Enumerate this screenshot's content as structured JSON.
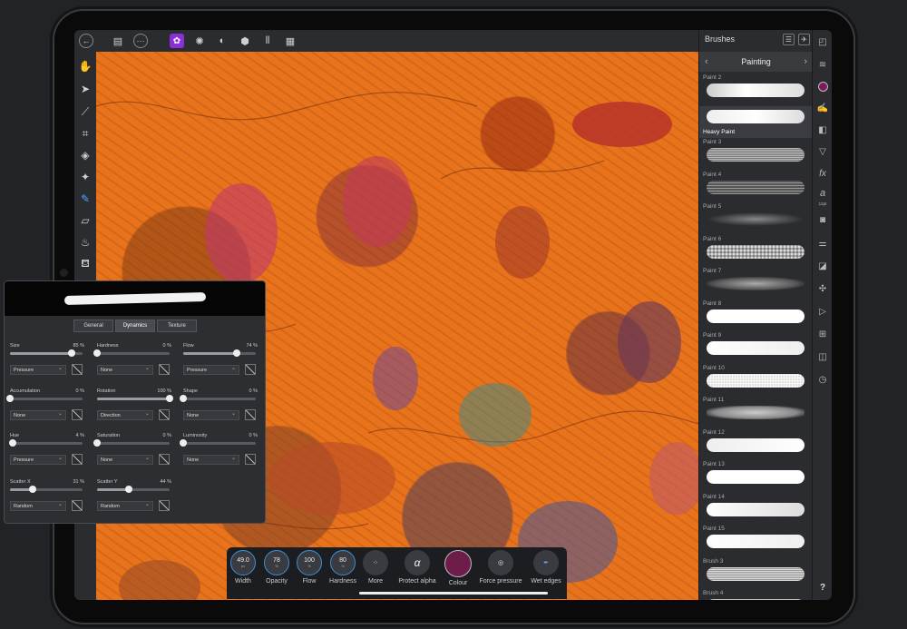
{
  "toolbar": {
    "back_icon": "←",
    "save_icon": "▤",
    "more_icon": "···",
    "persona_label": "✿"
  },
  "studio": {
    "title": "Brushes",
    "category": "Painting",
    "brushes": [
      {
        "label": "Paint 2",
        "selected": false
      },
      {
        "label": "Heavy Paint",
        "selected": true
      },
      {
        "label": "Paint 3",
        "selected": false
      },
      {
        "label": "Paint 4",
        "selected": false
      },
      {
        "label": "Paint 5",
        "selected": false
      },
      {
        "label": "Paint 6",
        "selected": false
      },
      {
        "label": "Paint 7",
        "selected": false
      },
      {
        "label": "Paint 8",
        "selected": false
      },
      {
        "label": "Paint 9",
        "selected": false
      },
      {
        "label": "Paint 10",
        "selected": false
      },
      {
        "label": "Paint 11",
        "selected": false
      },
      {
        "label": "Paint 12",
        "selected": false
      },
      {
        "label": "Paint 13",
        "selected": false
      },
      {
        "label": "Paint 14",
        "selected": false
      },
      {
        "label": "Paint 15",
        "selected": false
      },
      {
        "label": "Brush 3",
        "selected": false
      },
      {
        "label": "Brush 4",
        "selected": false
      }
    ]
  },
  "farright": {
    "font_size_label": "12pt",
    "help": "?"
  },
  "context": {
    "width_value": "49.0",
    "width_unit": "px",
    "width_label": "Width",
    "opacity_value": "78",
    "opacity_unit": "%",
    "opacity_label": "Opacity",
    "flow_value": "100",
    "flow_unit": "%",
    "flow_label": "Flow",
    "hardness_value": "80",
    "hardness_unit": "%",
    "hardness_label": "Hardness",
    "more_label": "More",
    "protect_alpha_label": "Protect alpha",
    "protect_alpha_glyph": "α",
    "colour_label": "Colour",
    "colour_value": "#6e1d4a",
    "force_pressure_label": "Force pressure",
    "wet_edges_label": "Wet edges"
  },
  "panel": {
    "tabs": [
      "General",
      "Dynamics",
      "Texture"
    ],
    "active_tab": "Dynamics",
    "params": [
      {
        "label": "Size",
        "value": "85 %",
        "fraction": 0.85,
        "mode": "Pressure"
      },
      {
        "label": "Hardness",
        "value": "0 %",
        "fraction": 0.0,
        "mode": "None"
      },
      {
        "label": "Flow",
        "value": "74 %",
        "fraction": 0.74,
        "mode": "Pressure"
      },
      {
        "label": "Accumulation",
        "value": "0 %",
        "fraction": 0.0,
        "mode": "None"
      },
      {
        "label": "Rotation",
        "value": "100 %",
        "fraction": 1.0,
        "mode": "Direction"
      },
      {
        "label": "Shape",
        "value": "0 %",
        "fraction": 0.0,
        "mode": "None"
      },
      {
        "label": "Hue",
        "value": "4 %",
        "fraction": 0.04,
        "mode": "Pressure"
      },
      {
        "label": "Saturation",
        "value": "0 %",
        "fraction": 0.0,
        "mode": "None"
      },
      {
        "label": "Luminosity",
        "value": "0 %",
        "fraction": 0.0,
        "mode": "None"
      },
      {
        "label": "Scatter X",
        "value": "31 %",
        "fraction": 0.31,
        "mode": "Random"
      },
      {
        "label": "Scatter Y",
        "value": "44 %",
        "fraction": 0.44,
        "mode": "Random"
      }
    ]
  }
}
